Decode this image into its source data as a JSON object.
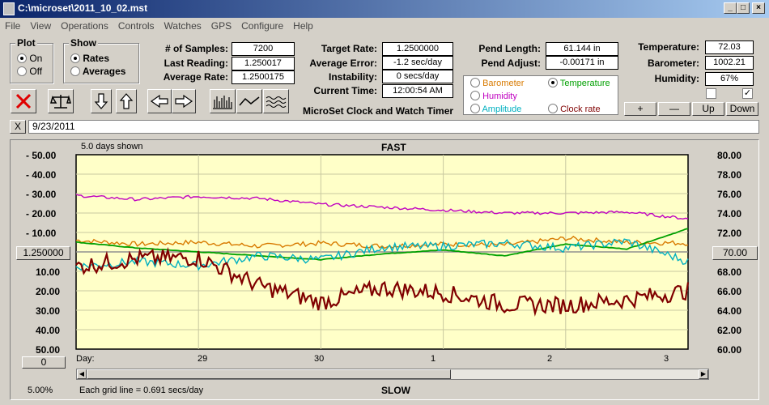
{
  "window": {
    "title": "C:\\microset\\2011_10_02.mst"
  },
  "menu": [
    "File",
    "View",
    "Operations",
    "Controls",
    "Watches",
    "GPS",
    "Configure",
    "Help"
  ],
  "plot": {
    "label": "Plot",
    "on": "On",
    "off": "Off",
    "selected": "On"
  },
  "show": {
    "label": "Show",
    "rates": "Rates",
    "averages": "Averages",
    "selected": "Rates"
  },
  "stats": {
    "samples_label": "# of Samples:",
    "samples": "7200",
    "last_label": "Last Reading:",
    "last": "1.250017",
    "avg_label": "Average Rate:",
    "avg": "1.2500175",
    "target_label": "Target Rate:",
    "target": "1.2500000",
    "avgerr_label": "Average Error:",
    "avgerr": "-1.2 sec/day",
    "instab_label": "Instability:",
    "instab": "0 secs/day",
    "time_label": "Current Time:",
    "time": "12:00:54 AM",
    "pendlen_label": "Pend Length:",
    "pendlen": "61.144 in",
    "pendadj_label": "Pend Adjust:",
    "pendadj": "-0.00171 in",
    "temp_label": "Temperature:",
    "temp": "72.03",
    "baro_label": "Barometer:",
    "baro": "1002.21",
    "hum_label": "Humidity:",
    "hum": "67%"
  },
  "app_caption": "MicroSet Clock and Watch Timer",
  "legend": {
    "barometer": "Barometer",
    "temperature": "Temperature",
    "humidity": "Humidity",
    "amplitude": "Amplitude",
    "clockrate": "Clock rate",
    "selected": "Temperature",
    "colors": {
      "barometer": "#d87a00",
      "temperature": "#00a000",
      "humidity": "#c000c0",
      "amplitude": "#00b0c0",
      "clockrate": "#800000"
    }
  },
  "adjust_buttons": {
    "plus": "+",
    "minus": "—",
    "up": "Up",
    "down": "Down"
  },
  "toolbar_icons": [
    "close-red-x",
    "balance-scale",
    "arrow-down",
    "arrow-up",
    "arrow-left",
    "arrow-right",
    "bar-graph",
    "line-graph",
    "wave-graph"
  ],
  "notes": {
    "close": "X",
    "text": "9/23/2011"
  },
  "chart": {
    "days_shown": "5.0 days shown",
    "top": "FAST",
    "bottom": "SLOW",
    "center_left": "1.250000",
    "center_right": "70.00",
    "left_ticks": [
      "-  50.00",
      "-  40.00",
      "-  30.00",
      "-  20.00",
      "-  10.00",
      "10.00",
      "20.00",
      "30.00",
      "40.00",
      "50.00"
    ],
    "right_ticks": [
      "80.00",
      "78.00",
      "76.00",
      "74.00",
      "72.00",
      "68.00",
      "66.00",
      "64.00",
      "62.00",
      "60.00"
    ],
    "x_label": "Day:",
    "x_ticks": [
      "29",
      "30",
      "1",
      "2",
      "3"
    ],
    "bottom_btn": "0",
    "grid_note": "Each grid line = 0.691 secs/day",
    "zoom": "5.00%"
  },
  "chart_data": {
    "type": "line",
    "title": "FAST",
    "x": [
      28,
      28.5,
      29,
      29.5,
      30,
      30.5,
      31,
      31.5,
      32,
      32.5,
      33
    ],
    "x_tick_labels": [
      "29",
      "30",
      "1",
      "2",
      "3"
    ],
    "y_left_label": "sec/day",
    "ylim_left": [
      50,
      -50
    ],
    "y_right_label": "Temperature",
    "ylim_right": [
      60,
      80
    ],
    "series": [
      {
        "name": "Barometer",
        "values": [
          71.2,
          70.8,
          71.0,
          70.6,
          70.9,
          70.6,
          70.8,
          70.7,
          71.4,
          71.0,
          70.9
        ]
      },
      {
        "name": "Temperature",
        "values": [
          71.0,
          70.4,
          70.0,
          69.6,
          69.2,
          69.8,
          70.2,
          69.6,
          70.8,
          70.3,
          72.4
        ]
      },
      {
        "name": "Humidity",
        "values": [
          75.8,
          75.4,
          75.7,
          75.5,
          74.9,
          74.6,
          74.3,
          74.0,
          74.0,
          74.1,
          73.4
        ]
      },
      {
        "name": "Amplitude",
        "values": [
          68.5,
          69.0,
          68.6,
          69.6,
          69.2,
          70.5,
          70.6,
          70.9,
          70.4,
          71.1,
          69.0
        ]
      },
      {
        "name": "Clock rate",
        "values": [
          68.5,
          69.3,
          69.4,
          66.5,
          64.8,
          66.3,
          65.8,
          64.6,
          64.5,
          65.1,
          66.0
        ]
      }
    ]
  }
}
